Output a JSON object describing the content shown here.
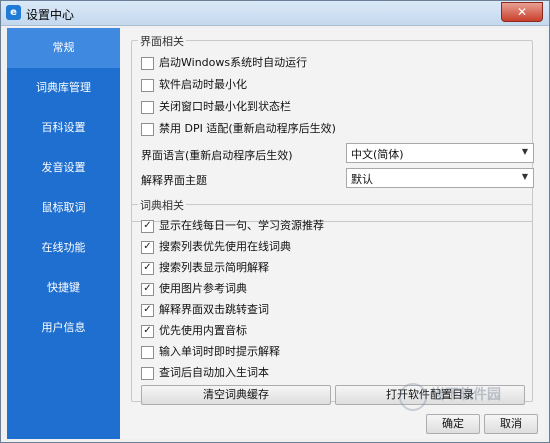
{
  "window": {
    "title": "设置中心",
    "app_icon": "e",
    "close_label": "✕"
  },
  "sidebar": {
    "items": [
      {
        "label": "常规",
        "active": true
      },
      {
        "label": "词典库管理",
        "active": false
      },
      {
        "label": "百科设置",
        "active": false
      },
      {
        "label": "发音设置",
        "active": false
      },
      {
        "label": "鼠标取词",
        "active": false
      },
      {
        "label": "在线功能",
        "active": false
      },
      {
        "label": "快捷键",
        "active": false
      },
      {
        "label": "用户信息",
        "active": false
      }
    ],
    "bg_color": "#1e6fd0",
    "active_color": "#3f8ae0"
  },
  "ui_group": {
    "title": "界面相关",
    "checkboxes": [
      {
        "label": "启动Windows系统时自动运行",
        "checked": false
      },
      {
        "label": "软件启动时最小化",
        "checked": false
      },
      {
        "label": "关闭窗口时最小化到状态栏",
        "checked": false
      },
      {
        "label": "禁用 DPI 适配(重新启动程序后生效)",
        "checked": false
      }
    ],
    "language_label": "界面语言(重新启动程序后生效)",
    "language_value": "中文(简体)",
    "theme_label": "解释界面主题",
    "theme_value": "默认"
  },
  "dict_group": {
    "title": "词典相关",
    "checkboxes": [
      {
        "label": "显示在线每日一句、学习资源推荐",
        "checked": true
      },
      {
        "label": "搜索列表优先使用在线词典",
        "checked": true
      },
      {
        "label": "搜索列表显示简明解释",
        "checked": true
      },
      {
        "label": "使用图片参考词典",
        "checked": true
      },
      {
        "label": "解释界面双击跳转查词",
        "checked": true
      },
      {
        "label": "优先使用内置音标",
        "checked": true
      },
      {
        "label": "输入单词时即时提示解释",
        "checked": false
      },
      {
        "label": "查词后自动加入生词本",
        "checked": false
      }
    ],
    "clear_cache_label": "清空词典缓存",
    "open_config_label": "打开软件配置目录"
  },
  "footer": {
    "ok_label": "确定",
    "cancel_label": "取消"
  },
  "watermark": {
    "text": "当下软件园"
  }
}
